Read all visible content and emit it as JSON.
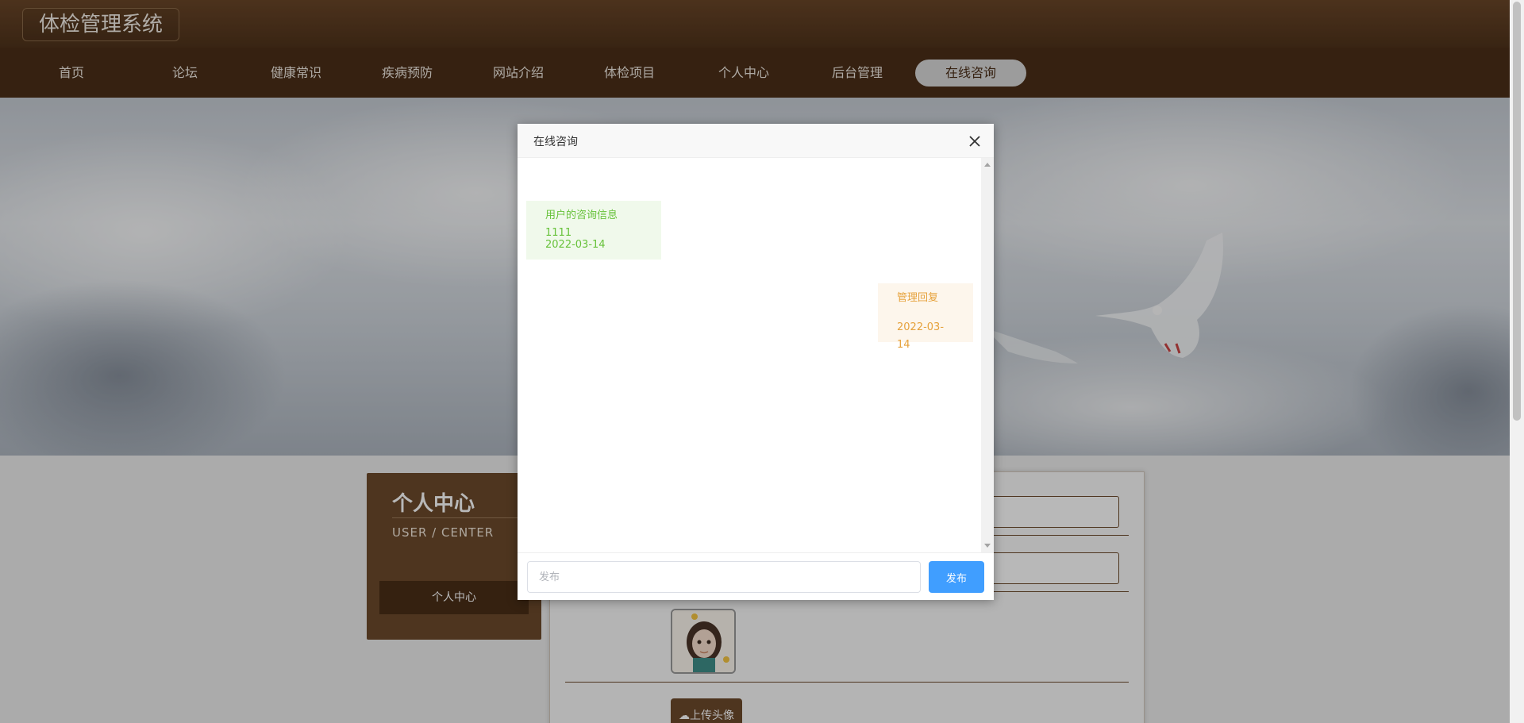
{
  "header": {
    "brand": "体检管理系统"
  },
  "nav": {
    "items": [
      "首页",
      "论坛",
      "健康常识",
      "疾病预防",
      "网站介绍",
      "体检项目",
      "个人中心",
      "后台管理",
      "在线咨询"
    ],
    "active_index": 8
  },
  "user_center": {
    "title": "个人中心",
    "subtitle": "USER / CENTER",
    "menu_button": "个人中心"
  },
  "profile_form": {
    "upload_button": "上传头像"
  },
  "chat_dialog": {
    "title": "在线咨询",
    "messages": [
      {
        "role": "user",
        "text": "用户的咨询信息1111",
        "date": "2022-03-14"
      },
      {
        "role": "admin",
        "text": "管理回复",
        "date": "2022-03-14"
      }
    ],
    "input_placeholder": "发布",
    "input_value": "",
    "send_button": "发布"
  },
  "colors": {
    "primary_brown": "#4b2f18",
    "panel_brown": "#6d4a2b",
    "user_bubble_bg": "#f0f9eb",
    "user_bubble_text": "#67c23a",
    "admin_bubble_bg": "#fdf6ec",
    "admin_bubble_text": "#e6a23c",
    "send_button": "#409eff"
  }
}
